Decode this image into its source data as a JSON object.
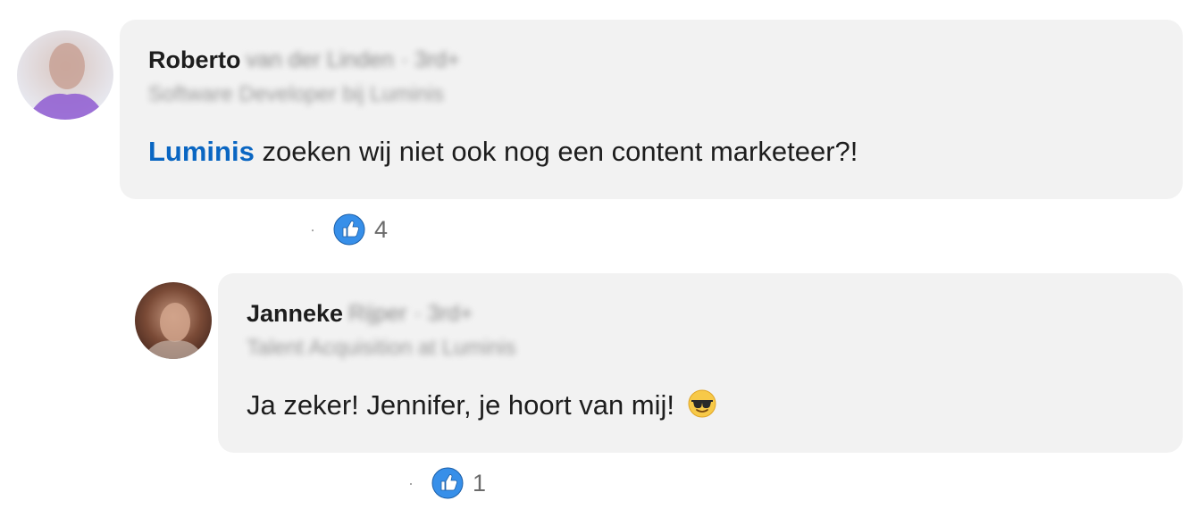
{
  "comments": [
    {
      "author_first": "Roberto",
      "author_rest": "van der Linden",
      "degree": "· 3rd+",
      "headline": "Software Developer bij Luminis",
      "mention": "Luminis",
      "text": " zoeken wij niet ook nog een content marketeer?!",
      "reaction_count": "4",
      "avatar_color": "#8e5bd1"
    },
    {
      "author_first": "Janneke",
      "author_rest": "Rijper",
      "degree": "· 3rd+",
      "headline": "Talent Acquisition at Luminis",
      "text": "Ja zeker! Jennifer, je hoort van mij!",
      "emoji": "smiling-face-with-sunglasses-icon",
      "reaction_count": "1",
      "avatar_color": "#6b3a2a"
    }
  ],
  "separator": "·",
  "colors": {
    "mention": "#0a66c2",
    "like_badge": "#378fe9",
    "bubble": "#f2f2f2"
  }
}
